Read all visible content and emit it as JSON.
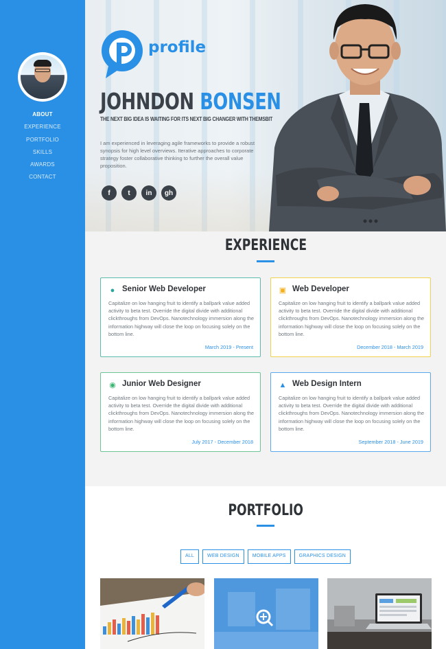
{
  "sidebar": {
    "nav": [
      "ABOUT",
      "EXPERIENCE",
      "PORTFOLIO",
      "SKILLS",
      "AWARDS",
      "CONTACT"
    ]
  },
  "hero": {
    "logo_text": "profile",
    "first_name": "JOHNDON",
    "last_name": "BONSEN",
    "tagline": "THE NEXT BIG IDEA IS WAITING FOR ITS NEXT BIG CHANGER WITH ",
    "tagline_brand": "THEMSBIT",
    "bio": "I am experienced in leveraging agile frameworks to provide a robust synopsis for high level overviews. Iterative approaches to corporate strategy foster collaborative thinking to further the overall value proposition.",
    "social_icons": [
      "facebook-icon",
      "twitter-icon",
      "linkedin-icon",
      "github-icon"
    ],
    "social_glyphs": [
      "f",
      "t",
      "in",
      "gh"
    ]
  },
  "experience": {
    "title": "EXPERIENCE",
    "cards": [
      {
        "title": "Senior Web Developer",
        "icon": "globe-icon",
        "body": "Capitalize on low hanging fruit to identify a ballpark value added activity to beta test. Override the digital divide with additional clickthroughs from DevOps. Nanotechnology immersion along the information highway will close the loop on focusing solely on the bottom line.",
        "date": "March 2019 - Present",
        "color": "#2ba59b"
      },
      {
        "title": "Web Developer",
        "icon": "laptop-icon",
        "body": "Capitalize on low hanging fruit to identify a ballpark value added activity to beta test. Override the digital divide with additional clickthroughs from DevOps. Nanotechnology immersion along the information highway will close the loop on focusing solely on the bottom line.",
        "date": "December 2018 - March 2019",
        "color": "#f2d14b"
      },
      {
        "title": "Junior Web Designer",
        "icon": "camera-icon",
        "body": "Capitalize on low hanging fruit to identify a ballpark value added activity to beta test. Override the digital divide with additional clickthroughs from DevOps. Nanotechnology immersion along the information highway will close the loop on focusing solely on the bottom line.",
        "date": "July 2017 - December 2018",
        "color": "#3cb371"
      },
      {
        "title": "Web Design Intern",
        "icon": "area-chart-icon",
        "body": "Capitalize on low hanging fruit to identify a ballpark value added activity to beta test. Override the digital divide with additional clickthroughs from DevOps. Nanotechnology immersion along the information highway will close the loop on focusing solely on the bottom line.",
        "date": "September 2018 - June 2019",
        "color": "#2a90e6"
      }
    ]
  },
  "portfolio": {
    "title": "PORTFOLIO",
    "filters": [
      "ALL",
      "WEB DESIGN",
      "MOBILE APPS",
      "GRAPHICS DESIGN"
    ]
  },
  "colors": {
    "accent": "#2a90e6",
    "dark": "#3b4148"
  }
}
